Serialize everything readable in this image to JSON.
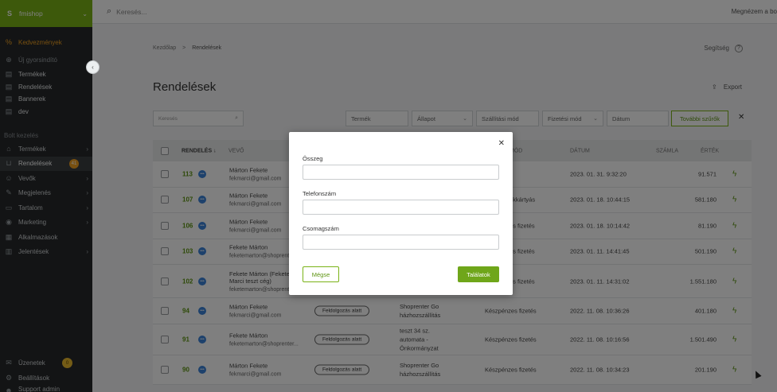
{
  "sidebar": {
    "shop_name": "fmishop",
    "promo": "Kedvezmények",
    "quick": "Új gyorsindító",
    "quick_links": [
      "Termékek",
      "Rendelések",
      "Bannerek",
      "dev"
    ],
    "section": "Bolt kezelés",
    "items": [
      {
        "label": "Termékek",
        "icon": "tag-icon"
      },
      {
        "label": "Rendelések",
        "icon": "basket-icon",
        "badge": "41"
      },
      {
        "label": "Vevők",
        "icon": "users-icon"
      },
      {
        "label": "Megjelenés",
        "icon": "brush-icon"
      },
      {
        "label": "Tartalom",
        "icon": "document-icon"
      },
      {
        "label": "Marketing",
        "icon": "globe-icon"
      },
      {
        "label": "Alkalmazások",
        "icon": "apps-icon"
      },
      {
        "label": "Jelentések",
        "icon": "bar-chart-icon"
      }
    ],
    "bottom": [
      {
        "label": "Üzenetek",
        "badge": "0"
      },
      {
        "label": "Beállítások"
      },
      {
        "label": "Support admin"
      }
    ]
  },
  "topbar": {
    "search_placeholder": "Keresés...",
    "right_link": "Megnézem a bo"
  },
  "breadcrumb": {
    "home": "Kezdőlap",
    "sep": ">",
    "current": "Rendelések"
  },
  "help": "Segítség",
  "title": "Rendelések",
  "export": "Export",
  "filters": {
    "search_placeholder": "Keresés",
    "product": "Termék",
    "status": "Állapot",
    "shipping": "Szállítási mód",
    "payment": "Fizetési mód",
    "date": "Dátum",
    "more": "További szűrők"
  },
  "table": {
    "headers": {
      "order": "RENDELÉS",
      "buyer": "VEVŐ",
      "payment": "MÓD",
      "date": "DÁTUM",
      "invoice": "SZÁMLA",
      "value": "ÉRTÉK"
    },
    "rows": [
      {
        "id": "113",
        "name": "Márton Fekete",
        "email": "fekmarci@gmail.com",
        "status": "",
        "ship": "",
        "pay": "",
        "date": "2023. 01. 31. 9:32:20",
        "value": "91.571"
      },
      {
        "id": "107",
        "name": "Márton Fekete",
        "email": "fekmarci@gmail.com",
        "status": "",
        "ship": "",
        "pay": "nkkártyás",
        "date": "2023. 01. 18. 10:44:15",
        "value": "581.180"
      },
      {
        "id": "106",
        "name": "Márton Fekete",
        "email": "fekmarci@gmail.com",
        "status": "",
        "ship": "",
        "pay": "es fizetés",
        "date": "2023. 01. 18. 10:14:42",
        "value": "81.190"
      },
      {
        "id": "103",
        "name": "Fekete Márton",
        "email": "feketemarton@shoprenter.",
        "status": "",
        "ship": "",
        "pay": "es fizetés",
        "date": "2023. 01. 11. 14:41:45",
        "value": "501.190"
      },
      {
        "id": "102",
        "name": "Fekete Márton (Fekete Marci teszt cég)",
        "email": "feketemarton@shoprente",
        "status": "",
        "ship": "",
        "pay": "es fizetés",
        "date": "2023. 01. 11. 14:31:02",
        "value": "1.551.180"
      },
      {
        "id": "94",
        "name": "Márton Fekete",
        "email": "fekmarci@gmail.com",
        "status": "Feldolgozás alatt",
        "ship": "Shoprenter Go házhozszállítás",
        "pay": "Készpénzes fizetés",
        "date": "2022. 11. 08. 10:36:26",
        "value": "401.180"
      },
      {
        "id": "91",
        "name": "Fekete Márton",
        "email": "feketemarton@shoprenter...",
        "status": "Feldolgozás alatt",
        "ship": "teszt 34 sz. automata - Önkormányzat",
        "pay": "Készpénzes fizetés",
        "date": "2022. 11. 08. 10:16:56",
        "value": "1.501.490"
      },
      {
        "id": "90",
        "name": "Márton Fekete",
        "email": "fekmarci@gmail.com",
        "status": "Feldolgozás alatt",
        "ship": "Shoprenter Go házhozszállítás",
        "pay": "Készpénzes fizetés",
        "date": "2022. 11. 08. 10:34:23",
        "value": "201.190"
      }
    ]
  },
  "modal": {
    "field1": "Összeg",
    "field2": "Telefonszám",
    "field3": "Csomagszám",
    "cancel": "Mégse",
    "submit": "Találatok"
  }
}
